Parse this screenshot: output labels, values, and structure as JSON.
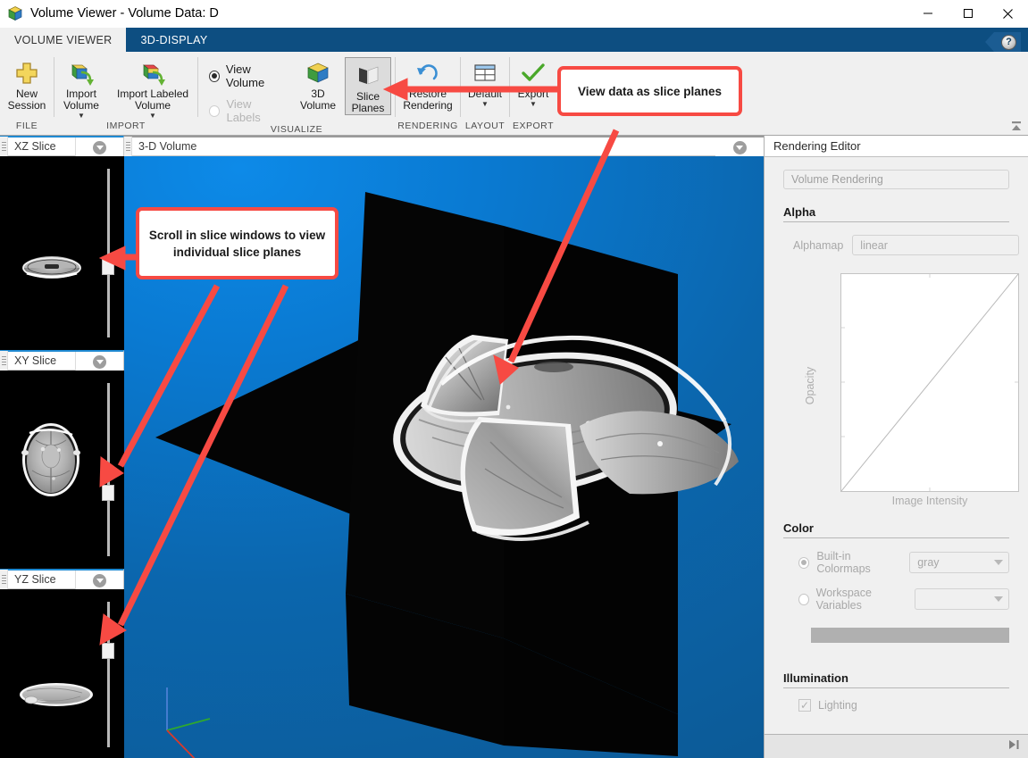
{
  "window": {
    "title": "Volume Viewer - Volume Data: D",
    "app_icon": "cube-icon",
    "minimize_label": "–",
    "maximize_label": "☐",
    "close_label": "✕"
  },
  "ribbon": {
    "tabs": [
      {
        "label": "VOLUME VIEWER",
        "active": true
      },
      {
        "label": "3D-DISPLAY",
        "active": false
      }
    ],
    "help_label": "?",
    "collapse_label": "collapse-ribbon-icon",
    "groups": [
      {
        "label": "FILE",
        "buttons": [
          {
            "name": "new-session-button",
            "label": "New\nSession",
            "icon": "plus-cross-icon",
            "caret": false,
            "pressed": false,
            "disabled": false
          }
        ]
      },
      {
        "label": "IMPORT",
        "buttons": [
          {
            "name": "import-volume-button",
            "label": "Import\nVolume",
            "icon": "import-volume-icon",
            "caret": true,
            "pressed": false,
            "disabled": false
          },
          {
            "name": "import-labeled-volume-button",
            "label": "Import Labeled\nVolume",
            "icon": "import-labeled-volume-icon",
            "caret": true,
            "pressed": false,
            "disabled": false
          }
        ]
      },
      {
        "label": "VISUALIZE",
        "radios": [
          {
            "name": "view-volume-radio",
            "label": "View Volume",
            "selected": true,
            "disabled": false
          },
          {
            "name": "view-labels-radio",
            "label": "View Labels",
            "selected": false,
            "disabled": true
          }
        ],
        "buttons": [
          {
            "name": "3d-volume-button",
            "label": "3D\nVolume",
            "icon": "colored-cube-icon",
            "caret": false,
            "pressed": false,
            "disabled": false
          },
          {
            "name": "slice-planes-button",
            "label": "Slice\nPlanes",
            "icon": "slice-planes-icon",
            "caret": false,
            "pressed": true,
            "disabled": false
          }
        ]
      },
      {
        "label": "RENDERING",
        "buttons": [
          {
            "name": "restore-rendering-button",
            "label": "Restore\nRendering",
            "icon": "undo-arrow-icon",
            "caret": false,
            "pressed": false,
            "disabled": false
          }
        ]
      },
      {
        "label": "LAYOUT",
        "buttons": [
          {
            "name": "default-layout-button",
            "label": "Default",
            "icon": "grid-layout-icon",
            "caret": true,
            "pressed": false,
            "disabled": false
          }
        ]
      },
      {
        "label": "EXPORT",
        "buttons": [
          {
            "name": "export-button",
            "label": "Export",
            "icon": "green-check-icon",
            "caret": true,
            "pressed": false,
            "disabled": false
          }
        ]
      }
    ]
  },
  "slice_panels": [
    {
      "name": "xz-slice-panel",
      "title": "XZ Slice",
      "dropdown_icon": "chevron-down-circle-icon",
      "slider_value_pct": 68
    },
    {
      "name": "xy-slice-panel",
      "title": "XY Slice",
      "dropdown_icon": "chevron-down-circle-icon",
      "slider_value_pct": 64
    },
    {
      "name": "yz-slice-panel",
      "title": "YZ Slice",
      "dropdown_icon": "chevron-down-circle-icon",
      "slider_value_pct": 36
    }
  ],
  "center": {
    "tab_title": "3-D Volume",
    "dropdown_icon": "chevron-down-circle-icon",
    "background_color": "#0a7ad2",
    "axes_triad": {
      "x_color": "#d93a2b",
      "y_color": "#2fa82f",
      "z_color": "#4a7fd4"
    }
  },
  "rendering_editor": {
    "header": "Rendering Editor",
    "mode_field": "Volume Rendering",
    "alpha": {
      "section_label": "Alpha",
      "alphamap_label": "Alphamap",
      "alphamap_value": "linear"
    },
    "plot": {
      "ylabel": "Opacity",
      "xlabel": "Image Intensity"
    },
    "color": {
      "section_label": "Color",
      "builtin_label": "Built-in Colormaps",
      "builtin_selected": true,
      "builtin_value": "gray",
      "workspace_label": "Workspace Variables",
      "workspace_selected": false,
      "workspace_value": "",
      "colorbar_color": "#b0b0b0"
    },
    "illumination": {
      "section_label": "Illumination",
      "lighting_label": "Lighting",
      "lighting_checked": true,
      "check_glyph": "✓"
    },
    "footer_icon": "expand-panel-icon"
  },
  "callouts": [
    {
      "name": "callout-slice-planes",
      "text": "View data as slice planes",
      "border_color": "#f74a43"
    },
    {
      "name": "callout-scroll-slices",
      "text": "Scroll in slice windows to view individual slice planes",
      "border_color": "#f74a43"
    }
  ],
  "chart_data": {
    "type": "line",
    "title": "",
    "xlabel": "Image Intensity",
    "ylabel": "Opacity",
    "x": [
      0,
      1
    ],
    "values": [
      0,
      1
    ],
    "xlim": [
      0,
      1
    ],
    "ylim": [
      0,
      1
    ],
    "grid": false,
    "legend": "none",
    "line_color": "#b9b9b9",
    "note": "linear alphamap ramp"
  }
}
